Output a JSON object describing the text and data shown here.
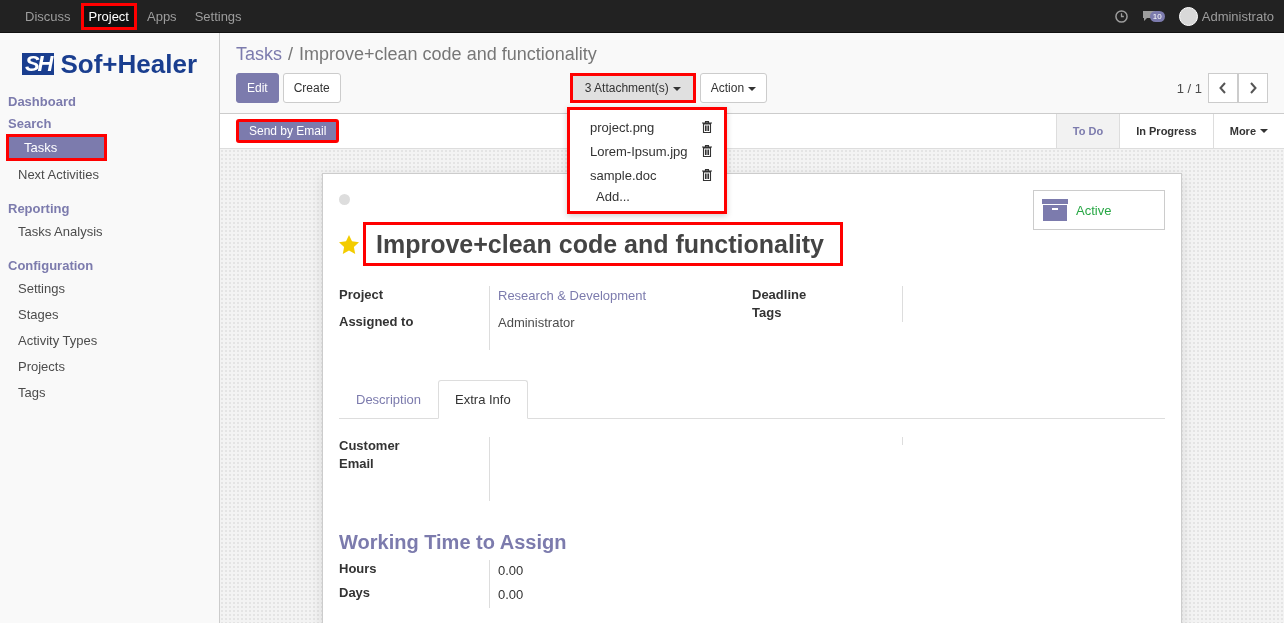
{
  "top_menu": [
    {
      "label": "Discuss",
      "selected": false,
      "highlighted": false
    },
    {
      "label": "Project",
      "selected": true,
      "highlighted": true
    },
    {
      "label": "Apps",
      "selected": false,
      "highlighted": false
    },
    {
      "label": "Settings",
      "selected": false,
      "highlighted": false
    }
  ],
  "systray": {
    "message_count": "10",
    "user": "Administrato"
  },
  "logo": {
    "mark": "SH",
    "name": "Sof+Healer"
  },
  "sidebar": {
    "sections": [
      {
        "title": "Dashboard"
      },
      {
        "title": "Search",
        "items": [
          {
            "label": "Tasks",
            "selected": true,
            "highlighted": true
          },
          {
            "label": "Next Activities",
            "selected": false,
            "highlighted": false
          }
        ]
      },
      {
        "title": "Reporting",
        "items": [
          {
            "label": "Tasks Analysis",
            "selected": false,
            "highlighted": false
          }
        ]
      },
      {
        "title": "Configuration",
        "items": [
          {
            "label": "Settings",
            "selected": false,
            "highlighted": false
          },
          {
            "label": "Stages",
            "selected": false,
            "highlighted": false
          },
          {
            "label": "Activity Types",
            "selected": false,
            "highlighted": false
          },
          {
            "label": "Projects",
            "selected": false,
            "highlighted": false
          },
          {
            "label": "Tags",
            "selected": false,
            "highlighted": false
          }
        ]
      }
    ]
  },
  "breadcrumb": {
    "parent": "Tasks",
    "separator": "/",
    "current": "Improve+clean code and functionality"
  },
  "buttons": [
    {
      "label": "Edit",
      "kind": "primary"
    },
    {
      "label": "Create",
      "kind": "default"
    }
  ],
  "attachments": {
    "label": "3 Attachment(s)",
    "highlighted": true,
    "expanded": true,
    "files": [
      "project.png",
      "Lorem-Ipsum.jpg",
      "sample.doc"
    ],
    "add_label": "Add..."
  },
  "action": {
    "label": "Action"
  },
  "pager": {
    "value": "1 / 1"
  },
  "send_button": {
    "label": "Send by Email",
    "highlighted": true
  },
  "stages": [
    {
      "label": "To Do",
      "selected": true,
      "kind": "stage"
    },
    {
      "label": "In Progress",
      "selected": false,
      "kind": "stage"
    },
    {
      "label": "More",
      "selected": false,
      "kind": "dropdown"
    }
  ],
  "task": {
    "starred": true,
    "title": "Improve+clean code and functionality",
    "title_highlighted": true,
    "active_label": "Active",
    "fields_left": [
      {
        "label": "Project",
        "value": "Research & Development",
        "kind": "link"
      },
      {
        "label": "Assigned to",
        "value": "Administrator",
        "kind": "text"
      }
    ],
    "fields_right": [
      {
        "label": "Deadline"
      },
      {
        "label": "Tags"
      }
    ]
  },
  "tabs": [
    {
      "label": "Description",
      "selected": false
    },
    {
      "label": "Extra Info",
      "selected": true
    }
  ],
  "extra_info": {
    "fields": [
      {
        "label": "Customer Email"
      }
    ]
  },
  "working_time": {
    "title": "Working Time to Assign",
    "fields": [
      {
        "label": "Hours",
        "value": "0.00"
      },
      {
        "label": "Days",
        "value": "0.00"
      }
    ]
  }
}
